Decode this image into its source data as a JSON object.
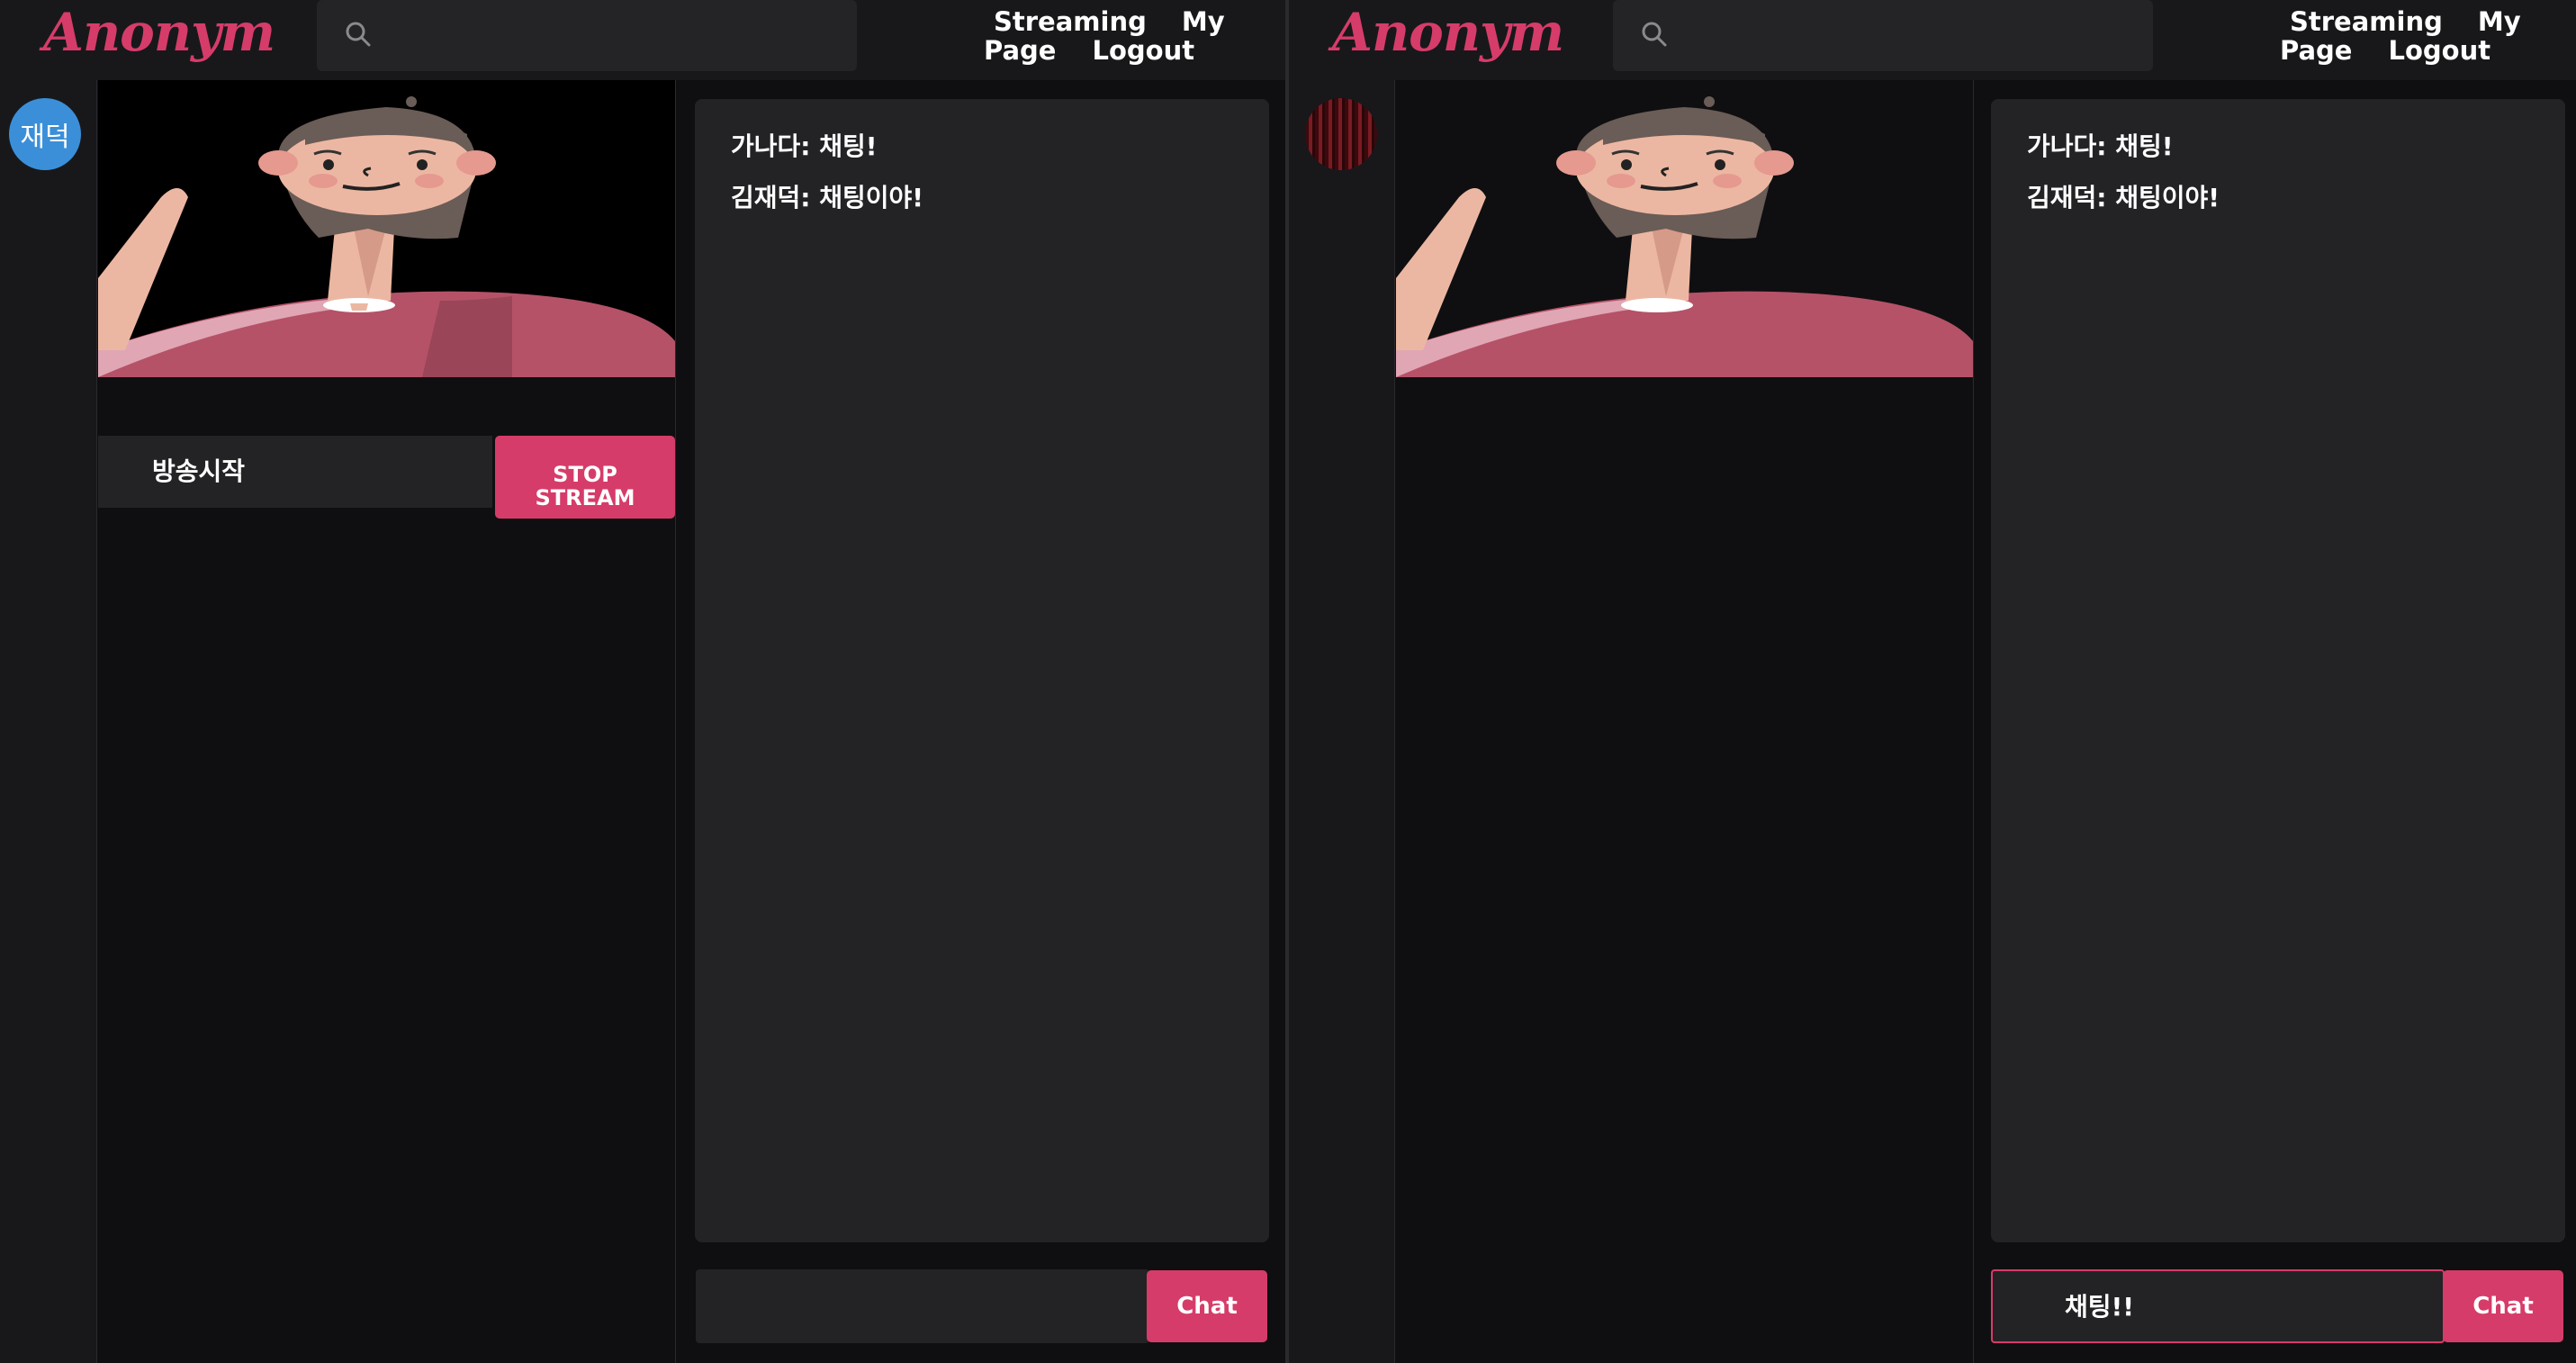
{
  "app": {
    "logo": "Anonym",
    "accent": "#d63c69"
  },
  "nav": {
    "streaming": "Streaming",
    "my_page_1": "My",
    "my_page_2": "Page",
    "logout": "Logout"
  },
  "left": {
    "avatar_label": "재덕",
    "stream_title": "방송시작",
    "stop_label_1": "STOP",
    "stop_label_2": "STREAM",
    "messages": [
      "가나다: 채팅!",
      "김재덕: 채팅이야!"
    ],
    "chat_input_value": "",
    "chat_button": "Chat"
  },
  "right": {
    "messages": [
      "가나다: 채팅!",
      "김재덕: 채팅이야!"
    ],
    "chat_input_value": "채팅!!",
    "chat_button": "Chat"
  },
  "icons": {
    "search": "search-icon",
    "viewer_avatar": "avatar-image"
  }
}
